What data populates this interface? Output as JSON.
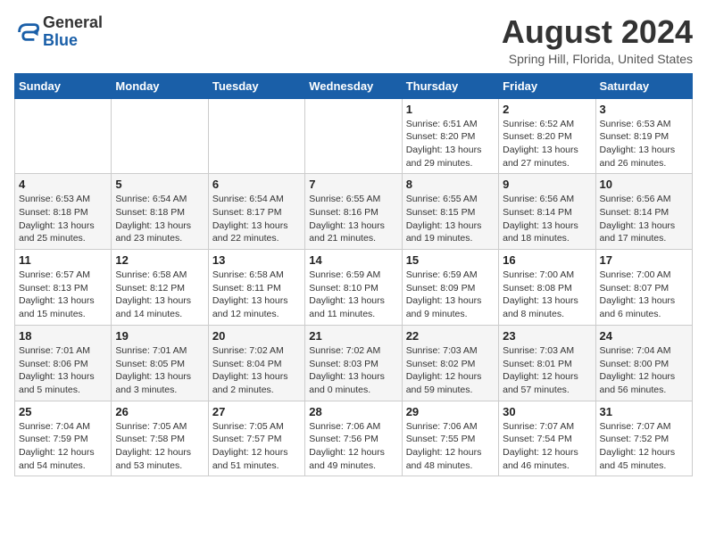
{
  "header": {
    "logo": {
      "general": "General",
      "blue": "Blue"
    },
    "title": "August 2024",
    "subtitle": "Spring Hill, Florida, United States"
  },
  "days_of_week": [
    "Sunday",
    "Monday",
    "Tuesday",
    "Wednesday",
    "Thursday",
    "Friday",
    "Saturday"
  ],
  "weeks": [
    [
      {
        "day": "",
        "info": ""
      },
      {
        "day": "",
        "info": ""
      },
      {
        "day": "",
        "info": ""
      },
      {
        "day": "",
        "info": ""
      },
      {
        "day": "1",
        "info": "Sunrise: 6:51 AM\nSunset: 8:20 PM\nDaylight: 13 hours and 29 minutes."
      },
      {
        "day": "2",
        "info": "Sunrise: 6:52 AM\nSunset: 8:20 PM\nDaylight: 13 hours and 27 minutes."
      },
      {
        "day": "3",
        "info": "Sunrise: 6:53 AM\nSunset: 8:19 PM\nDaylight: 13 hours and 26 minutes."
      }
    ],
    [
      {
        "day": "4",
        "info": "Sunrise: 6:53 AM\nSunset: 8:18 PM\nDaylight: 13 hours and 25 minutes."
      },
      {
        "day": "5",
        "info": "Sunrise: 6:54 AM\nSunset: 8:18 PM\nDaylight: 13 hours and 23 minutes."
      },
      {
        "day": "6",
        "info": "Sunrise: 6:54 AM\nSunset: 8:17 PM\nDaylight: 13 hours and 22 minutes."
      },
      {
        "day": "7",
        "info": "Sunrise: 6:55 AM\nSunset: 8:16 PM\nDaylight: 13 hours and 21 minutes."
      },
      {
        "day": "8",
        "info": "Sunrise: 6:55 AM\nSunset: 8:15 PM\nDaylight: 13 hours and 19 minutes."
      },
      {
        "day": "9",
        "info": "Sunrise: 6:56 AM\nSunset: 8:14 PM\nDaylight: 13 hours and 18 minutes."
      },
      {
        "day": "10",
        "info": "Sunrise: 6:56 AM\nSunset: 8:14 PM\nDaylight: 13 hours and 17 minutes."
      }
    ],
    [
      {
        "day": "11",
        "info": "Sunrise: 6:57 AM\nSunset: 8:13 PM\nDaylight: 13 hours and 15 minutes."
      },
      {
        "day": "12",
        "info": "Sunrise: 6:58 AM\nSunset: 8:12 PM\nDaylight: 13 hours and 14 minutes."
      },
      {
        "day": "13",
        "info": "Sunrise: 6:58 AM\nSunset: 8:11 PM\nDaylight: 13 hours and 12 minutes."
      },
      {
        "day": "14",
        "info": "Sunrise: 6:59 AM\nSunset: 8:10 PM\nDaylight: 13 hours and 11 minutes."
      },
      {
        "day": "15",
        "info": "Sunrise: 6:59 AM\nSunset: 8:09 PM\nDaylight: 13 hours and 9 minutes."
      },
      {
        "day": "16",
        "info": "Sunrise: 7:00 AM\nSunset: 8:08 PM\nDaylight: 13 hours and 8 minutes."
      },
      {
        "day": "17",
        "info": "Sunrise: 7:00 AM\nSunset: 8:07 PM\nDaylight: 13 hours and 6 minutes."
      }
    ],
    [
      {
        "day": "18",
        "info": "Sunrise: 7:01 AM\nSunset: 8:06 PM\nDaylight: 13 hours and 5 minutes."
      },
      {
        "day": "19",
        "info": "Sunrise: 7:01 AM\nSunset: 8:05 PM\nDaylight: 13 hours and 3 minutes."
      },
      {
        "day": "20",
        "info": "Sunrise: 7:02 AM\nSunset: 8:04 PM\nDaylight: 13 hours and 2 minutes."
      },
      {
        "day": "21",
        "info": "Sunrise: 7:02 AM\nSunset: 8:03 PM\nDaylight: 13 hours and 0 minutes."
      },
      {
        "day": "22",
        "info": "Sunrise: 7:03 AM\nSunset: 8:02 PM\nDaylight: 12 hours and 59 minutes."
      },
      {
        "day": "23",
        "info": "Sunrise: 7:03 AM\nSunset: 8:01 PM\nDaylight: 12 hours and 57 minutes."
      },
      {
        "day": "24",
        "info": "Sunrise: 7:04 AM\nSunset: 8:00 PM\nDaylight: 12 hours and 56 minutes."
      }
    ],
    [
      {
        "day": "25",
        "info": "Sunrise: 7:04 AM\nSunset: 7:59 PM\nDaylight: 12 hours and 54 minutes."
      },
      {
        "day": "26",
        "info": "Sunrise: 7:05 AM\nSunset: 7:58 PM\nDaylight: 12 hours and 53 minutes."
      },
      {
        "day": "27",
        "info": "Sunrise: 7:05 AM\nSunset: 7:57 PM\nDaylight: 12 hours and 51 minutes."
      },
      {
        "day": "28",
        "info": "Sunrise: 7:06 AM\nSunset: 7:56 PM\nDaylight: 12 hours and 49 minutes."
      },
      {
        "day": "29",
        "info": "Sunrise: 7:06 AM\nSunset: 7:55 PM\nDaylight: 12 hours and 48 minutes."
      },
      {
        "day": "30",
        "info": "Sunrise: 7:07 AM\nSunset: 7:54 PM\nDaylight: 12 hours and 46 minutes."
      },
      {
        "day": "31",
        "info": "Sunrise: 7:07 AM\nSunset: 7:52 PM\nDaylight: 12 hours and 45 minutes."
      }
    ]
  ]
}
